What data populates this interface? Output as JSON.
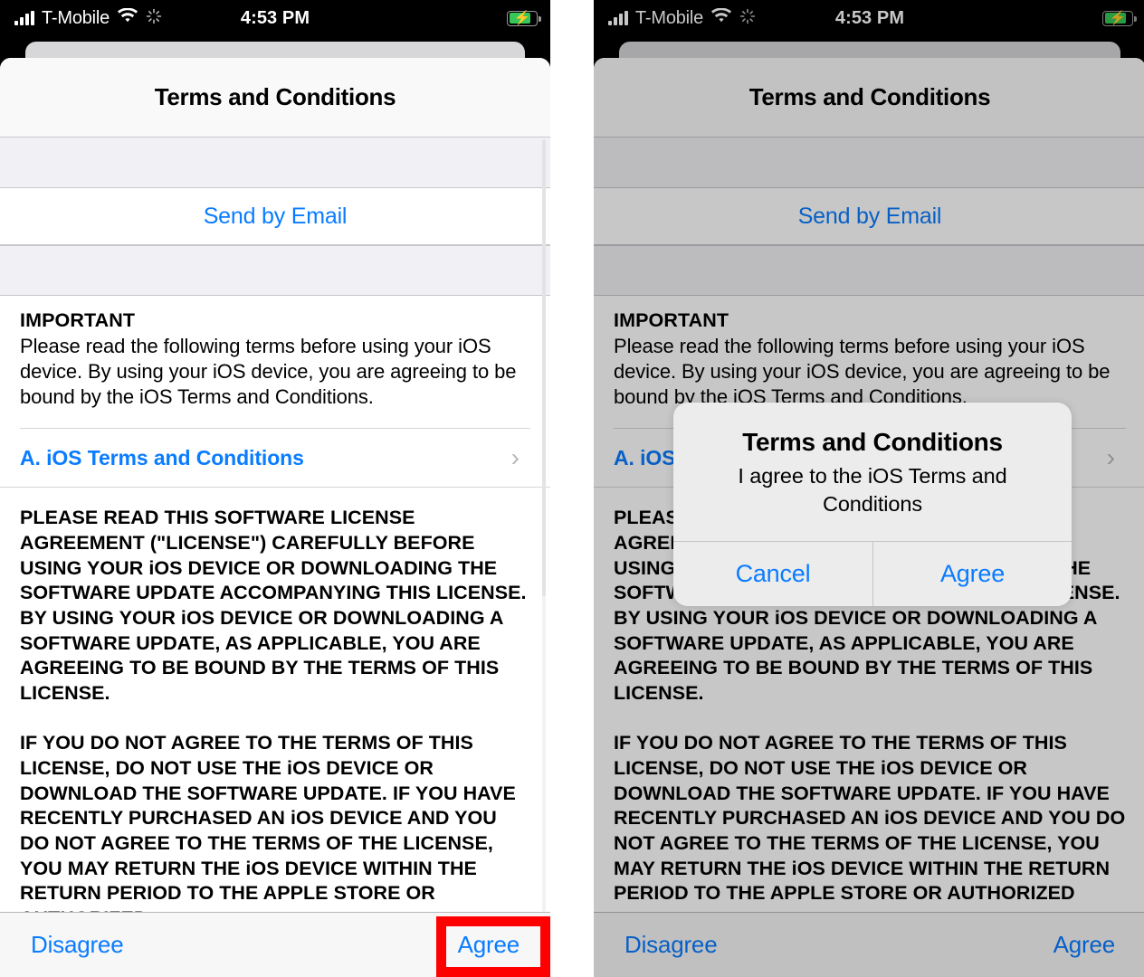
{
  "status_bar": {
    "signal_icon": "cellular-signal-icon",
    "carrier": "T-Mobile",
    "wifi_icon": "wifi-icon",
    "activity_icon": "activity-spinner-icon",
    "time": "4:53 PM",
    "battery_icon": "battery-charging-icon",
    "battery_level_percent": 82
  },
  "navbar": {
    "title": "Terms and Conditions"
  },
  "table": {
    "send_by_email": "Send by Email"
  },
  "document": {
    "heading": "IMPORTANT",
    "intro": "Please read the following terms before using your iOS device. By using your iOS device, you are agreeing to be bound by the iOS Terms and Conditions.",
    "link_row": {
      "label": "A. iOS Terms and Conditions",
      "chevron_icon": "chevron-right-icon"
    },
    "paragraphs": [
      "PLEASE READ THIS SOFTWARE LICENSE AGREEMENT (\"LICENSE\") CAREFULLY BEFORE USING YOUR iOS DEVICE OR DOWNLOADING THE SOFTWARE UPDATE ACCOMPANYING THIS LICENSE. BY USING YOUR iOS DEVICE OR DOWNLOADING A SOFTWARE UPDATE, AS APPLICABLE, YOU ARE AGREEING TO BE BOUND BY THE TERMS OF THIS LICENSE.",
      "IF YOU DO NOT AGREE TO THE TERMS OF THIS LICENSE, DO NOT USE THE iOS DEVICE OR DOWNLOAD THE SOFTWARE UPDATE. IF YOU HAVE RECENTLY PURCHASED AN iOS DEVICE AND YOU DO NOT AGREE TO THE TERMS OF THE LICENSE, YOU MAY RETURN THE iOS DEVICE WITHIN THE RETURN PERIOD TO THE APPLE STORE OR AUTHORIZED"
    ]
  },
  "toolbar": {
    "disagree": "Disagree",
    "agree": "Agree"
  },
  "alert": {
    "title": "Terms and Conditions",
    "message": "I agree to the iOS Terms and Conditions",
    "cancel": "Cancel",
    "agree": "Agree"
  },
  "annotation": {
    "highlight_color": "#fe0000"
  },
  "colors": {
    "tint_blue": "#0a7cff",
    "battery_green": "#35c759",
    "separator": "#c8c7cc",
    "group_background": "#f1f1f5"
  }
}
